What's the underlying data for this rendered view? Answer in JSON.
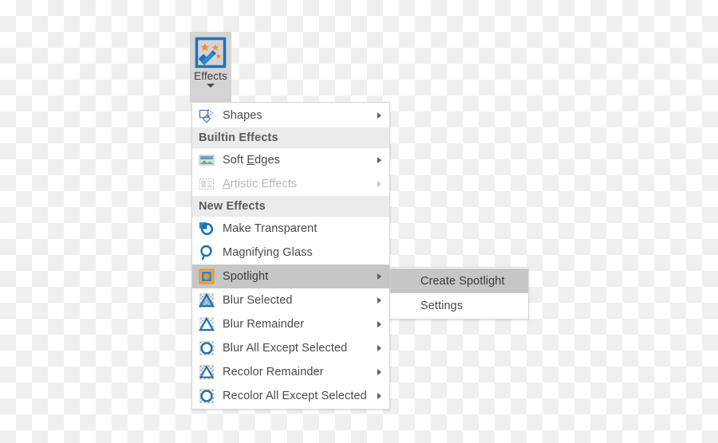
{
  "ribbon": {
    "effects_button": {
      "label": "Effects",
      "icon": "magic-wand-effects-icon",
      "caret": "chevron-down-icon"
    }
  },
  "menu": {
    "name": "effects-dropdown-menu",
    "entries": [
      {
        "kind": "item",
        "label": "Shapes",
        "icon": "shapes-icon",
        "submenu": true,
        "disabled": false,
        "highlighted": false,
        "accel": ""
      },
      {
        "kind": "header",
        "label": "Builtin Effects"
      },
      {
        "kind": "item",
        "label": "Soft Edges",
        "icon": "soft-edges-icon",
        "submenu": true,
        "disabled": false,
        "highlighted": false,
        "accel": "E"
      },
      {
        "kind": "item",
        "label": "Artistic Effects",
        "icon": "artistic-effects-icon",
        "submenu": true,
        "disabled": true,
        "highlighted": false,
        "accel": "A"
      },
      {
        "kind": "header",
        "label": "New Effects"
      },
      {
        "kind": "item",
        "label": "Make Transparent",
        "icon": "make-transparent-icon",
        "submenu": false,
        "disabled": false,
        "highlighted": false,
        "accel": ""
      },
      {
        "kind": "item",
        "label": "Magnifying Glass",
        "icon": "magnifying-glass-icon",
        "submenu": false,
        "disabled": false,
        "highlighted": false,
        "accel": ""
      },
      {
        "kind": "item",
        "label": "Spotlight",
        "icon": "spotlight-icon",
        "submenu": true,
        "disabled": false,
        "highlighted": true,
        "accel": ""
      },
      {
        "kind": "item",
        "label": "Blur Selected",
        "icon": "blur-selected-icon",
        "submenu": true,
        "disabled": false,
        "highlighted": false,
        "accel": ""
      },
      {
        "kind": "item",
        "label": "Blur Remainder",
        "icon": "blur-remainder-icon",
        "submenu": true,
        "disabled": false,
        "highlighted": false,
        "accel": ""
      },
      {
        "kind": "item",
        "label": "Blur All Except Selected",
        "icon": "blur-all-except-selected-icon",
        "submenu": true,
        "disabled": false,
        "highlighted": false,
        "accel": ""
      },
      {
        "kind": "item",
        "label": "Recolor Remainder",
        "icon": "recolor-remainder-icon",
        "submenu": true,
        "disabled": false,
        "highlighted": false,
        "accel": ""
      },
      {
        "kind": "item",
        "label": "Recolor All Except Selected",
        "icon": "recolor-all-except-selected-icon",
        "submenu": true,
        "disabled": false,
        "highlighted": false,
        "accel": ""
      }
    ]
  },
  "submenu": {
    "name": "spotlight-submenu",
    "parent": "Spotlight",
    "items": [
      {
        "label": "Create Spotlight",
        "highlighted": true
      },
      {
        "label": "Settings",
        "highlighted": false
      }
    ]
  },
  "colors": {
    "accent_blue": "#1a73b8",
    "accent_orange": "#f0922b",
    "menu_background": "#ffffff",
    "menu_border": "#d8d8d8",
    "header_background": "#ebebeb",
    "highlight_background": "#c6c6c6",
    "ribbon_button_background": "#d4d4d4",
    "text": "#4a4a4a",
    "text_disabled": "#b6b6b6",
    "checker_light": "#ffffff",
    "checker_dark": "#efefef"
  }
}
